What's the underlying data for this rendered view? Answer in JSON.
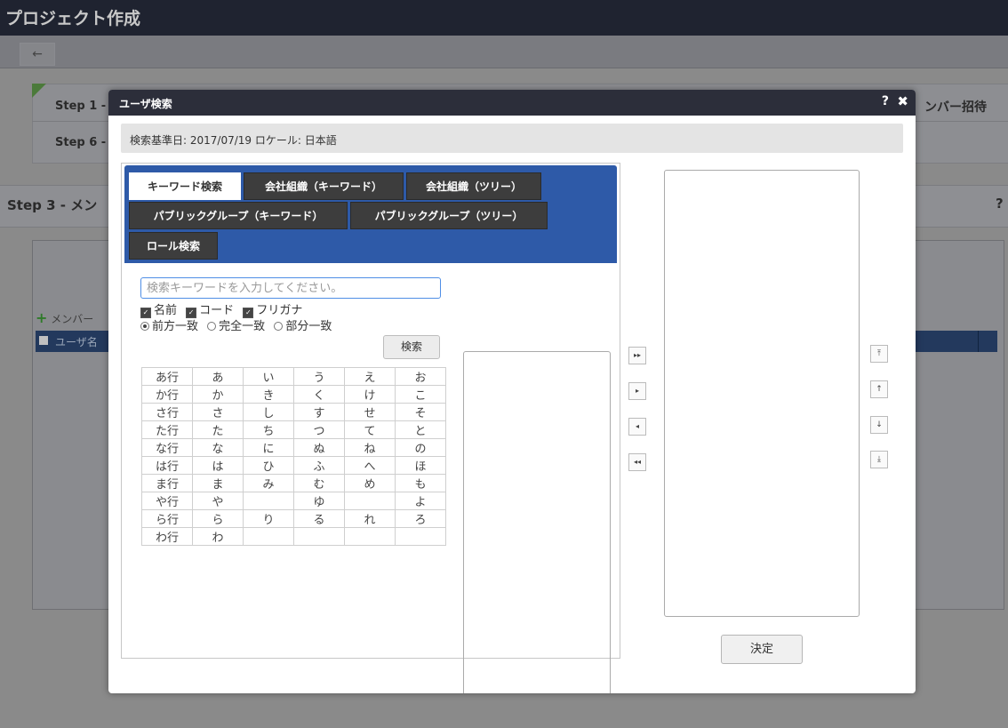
{
  "page": {
    "title": "プロジェクト作成",
    "back_icon": "←",
    "step1": "Step 1 -",
    "step6": "Step 6 -",
    "invite": "ンバー招待",
    "section_title": "Step 3 - メン",
    "help": "?",
    "add_member": "メンバー",
    "grid_user": "ユーザ名"
  },
  "modal": {
    "title": "ユーザ検索",
    "help": "?",
    "close": "✖",
    "info": "検索基準日:  2017/07/19    ロケール:  日本語",
    "tabs": [
      {
        "label": "キーワード検索",
        "active": true
      },
      {
        "label": "会社組織（キーワード）",
        "active": false
      },
      {
        "label": "会社組織（ツリー）",
        "active": false
      },
      {
        "label": "パブリックグループ（キーワード）",
        "active": false
      },
      {
        "label": "パブリックグループ（ツリー）",
        "active": false
      },
      {
        "label": "ロール検索",
        "active": false
      }
    ],
    "keyword_placeholder": "検索キーワードを入力してください。",
    "checks": [
      "名前",
      "コード",
      "フリガナ"
    ],
    "radios": [
      "前方一致",
      "完全一致",
      "部分一致"
    ],
    "search_button": "検索",
    "kana_rows": [
      [
        "あ行",
        "あ",
        "い",
        "う",
        "え",
        "お"
      ],
      [
        "か行",
        "か",
        "き",
        "く",
        "け",
        "こ"
      ],
      [
        "さ行",
        "さ",
        "し",
        "す",
        "せ",
        "そ"
      ],
      [
        "た行",
        "た",
        "ち",
        "つ",
        "て",
        "と"
      ],
      [
        "な行",
        "な",
        "に",
        "ぬ",
        "ね",
        "の"
      ],
      [
        "は行",
        "は",
        "ひ",
        "ふ",
        "へ",
        "ほ"
      ],
      [
        "ま行",
        "ま",
        "み",
        "む",
        "め",
        "も"
      ],
      [
        "や行",
        "や",
        "",
        "ゆ",
        "",
        "よ"
      ],
      [
        "ら行",
        "ら",
        "り",
        "る",
        "れ",
        "ろ"
      ],
      [
        "わ行",
        "わ",
        "",
        "",
        "",
        ""
      ]
    ],
    "transfer_buttons": {
      "add_all": "▸▸",
      "add": "▸",
      "remove": "◂",
      "remove_all": "◂◂"
    },
    "order_buttons": {
      "top": "⤒",
      "up": "↑",
      "down": "↓",
      "bottom": "⤓"
    },
    "decide_button": "決定"
  }
}
